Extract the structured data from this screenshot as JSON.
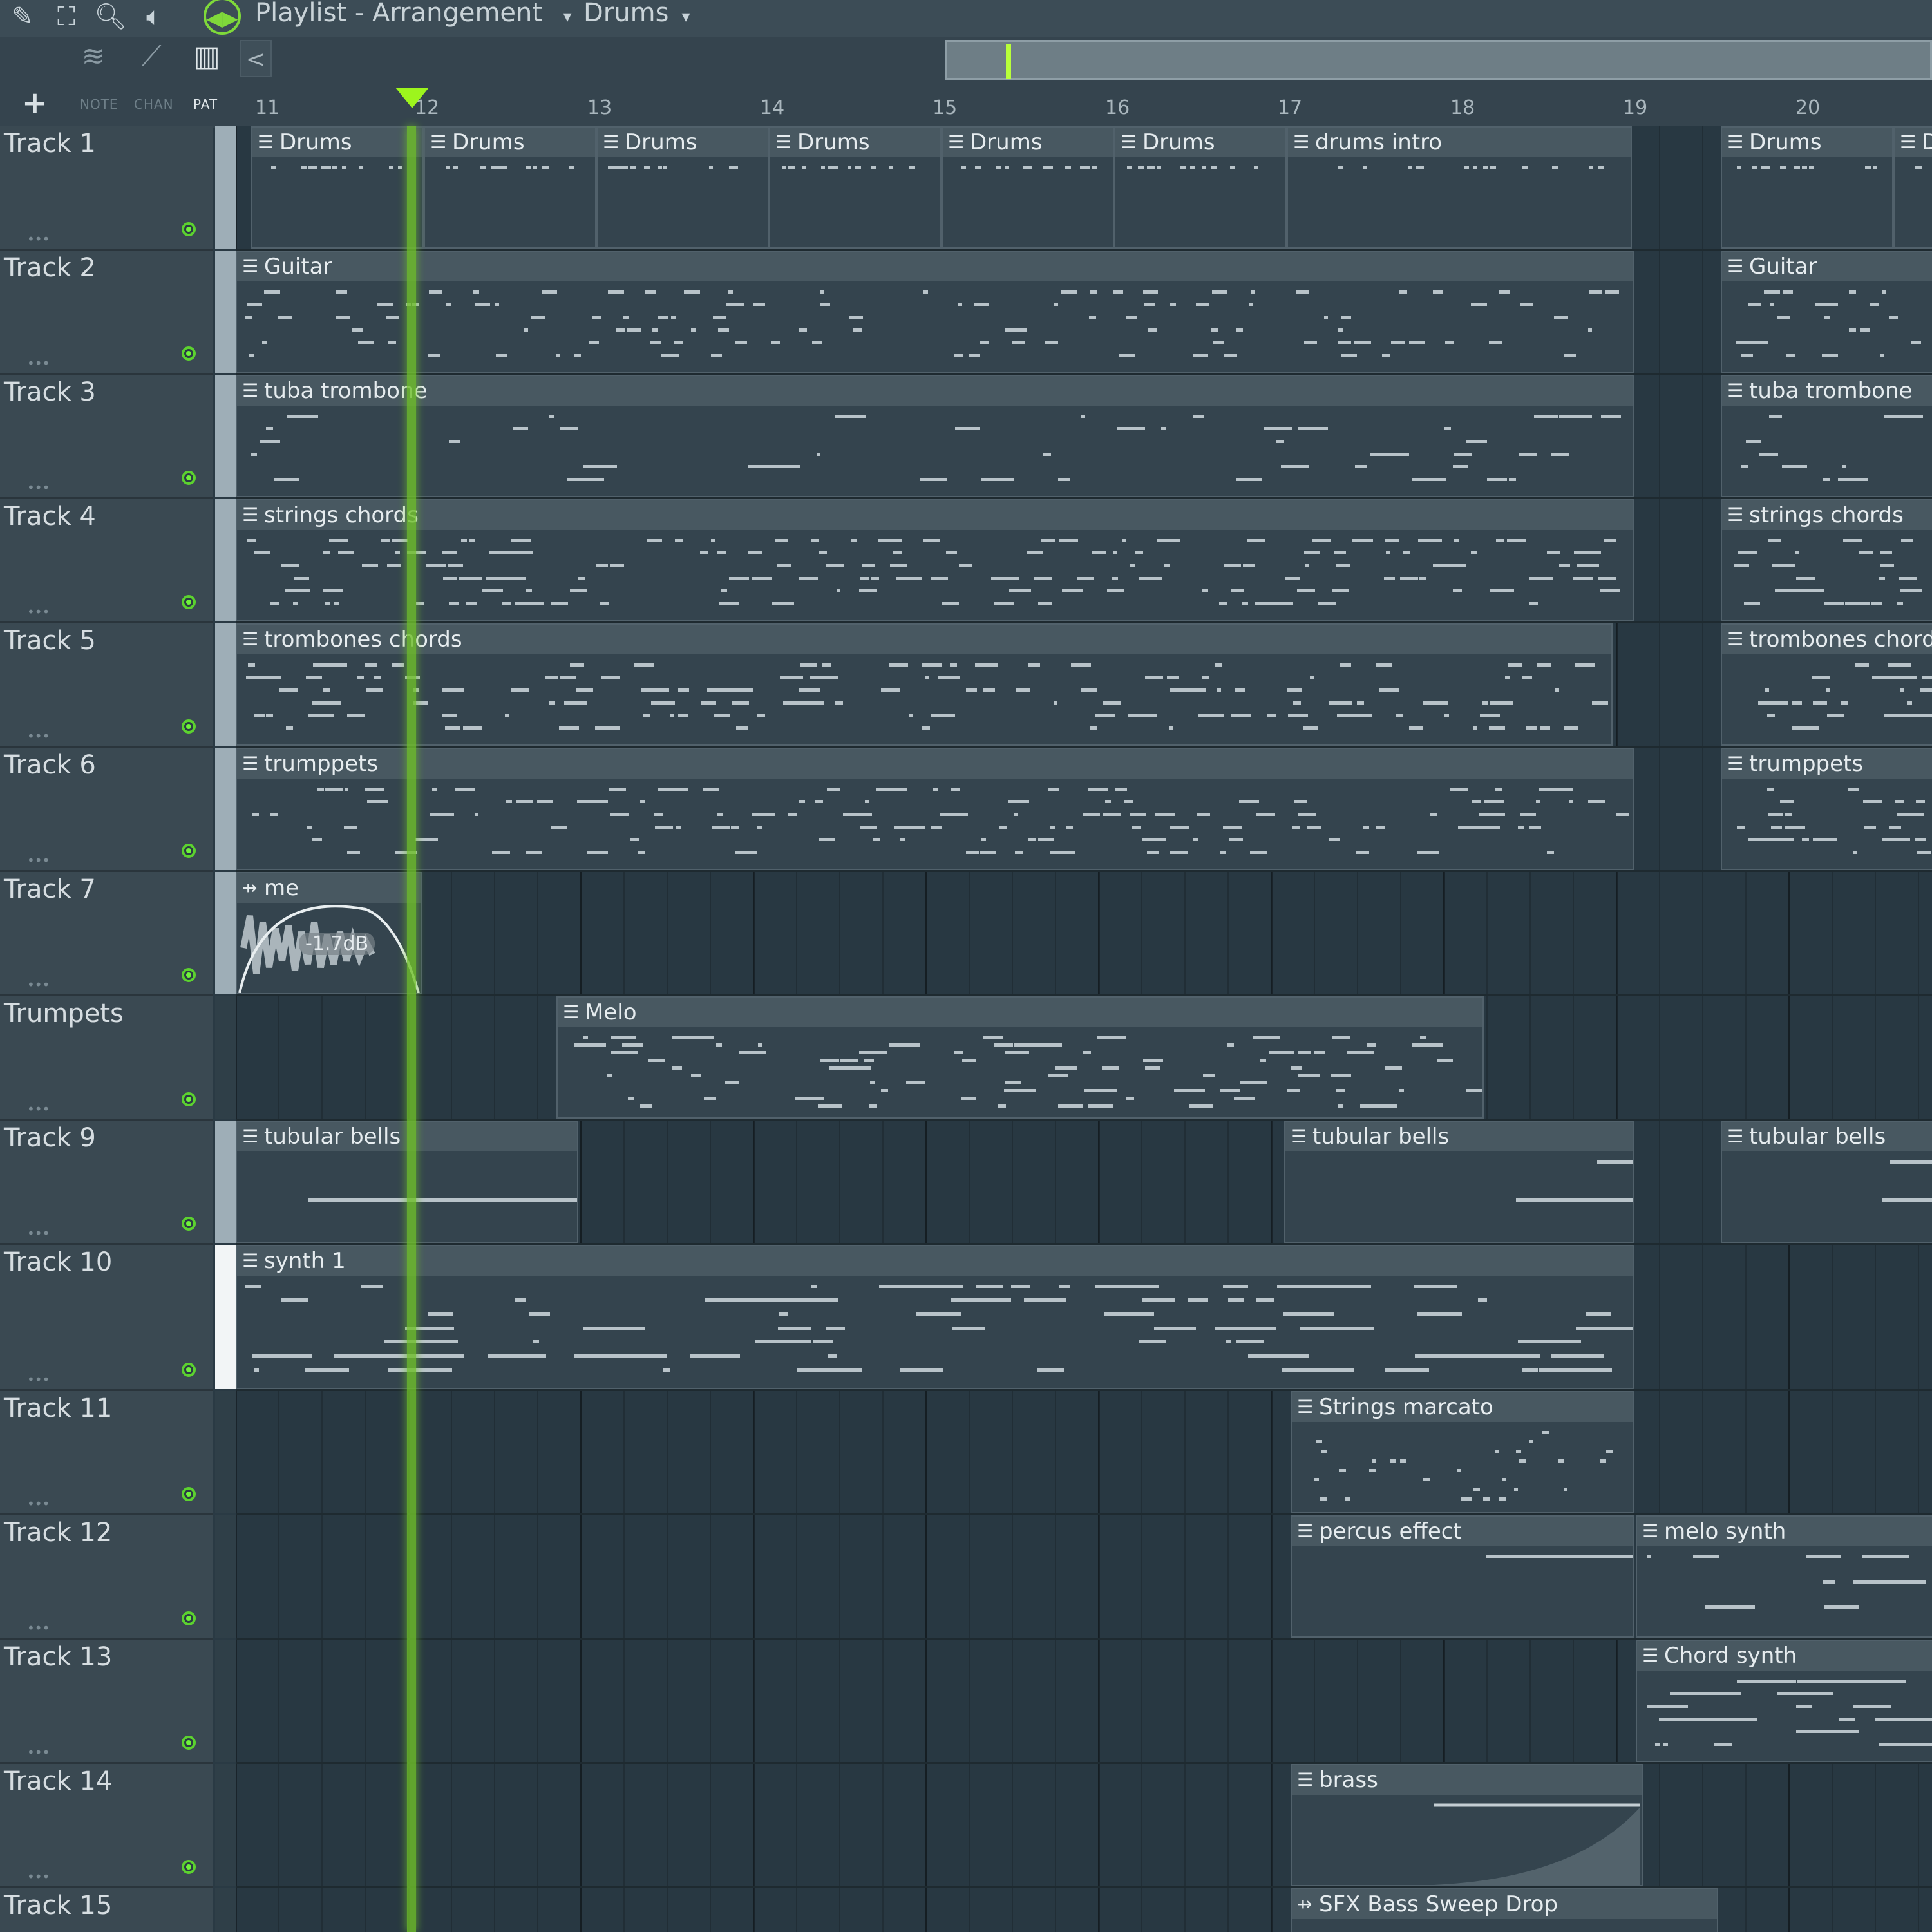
{
  "window": {
    "title": "Playlist - Arrangement",
    "pattern": "Drums"
  },
  "toolbar": {
    "labels": {
      "note": "NOTE",
      "chan": "CHAN",
      "pat": "PAT"
    },
    "add_label": "+",
    "scroll_left": "<"
  },
  "ruler": {
    "bars": [
      "11",
      "12",
      "13",
      "14",
      "15",
      "16",
      "17",
      "18",
      "19",
      "20"
    ]
  },
  "tracks": [
    {
      "name": "Track 1"
    },
    {
      "name": "Track 2"
    },
    {
      "name": "Track 3"
    },
    {
      "name": "Track 4"
    },
    {
      "name": "Track 5"
    },
    {
      "name": "Track 6"
    },
    {
      "name": "Track 7"
    },
    {
      "name": "Trumpets"
    },
    {
      "name": "Track 9"
    },
    {
      "name": "Track 10"
    },
    {
      "name": "Track 11"
    },
    {
      "name": "Track 12"
    },
    {
      "name": "Track 13"
    },
    {
      "name": "Track 14"
    },
    {
      "name": "Track 15"
    }
  ],
  "clips": {
    "drums": "Drums",
    "drums_intro": "drums intro",
    "guitar": "Guitar",
    "tuba": "tuba trombone",
    "strings": "strings chords",
    "trombones": "trombones chords",
    "trumpets": "trumppets",
    "audio": "me",
    "audio_gain": "-1.7dB",
    "melo": "Melo",
    "tubular": "tubular bells",
    "synth": "synth 1",
    "strings_marcato": "Strings marcato",
    "percus": "percus effect",
    "melo_synth": "melo synth",
    "chord_synth": "Chord synth",
    "brass": "brass",
    "sfx": "SFX Bass Sweep Drop"
  },
  "colors": {
    "accent_green": "#6fc02a",
    "playhead": "#9df51d"
  }
}
